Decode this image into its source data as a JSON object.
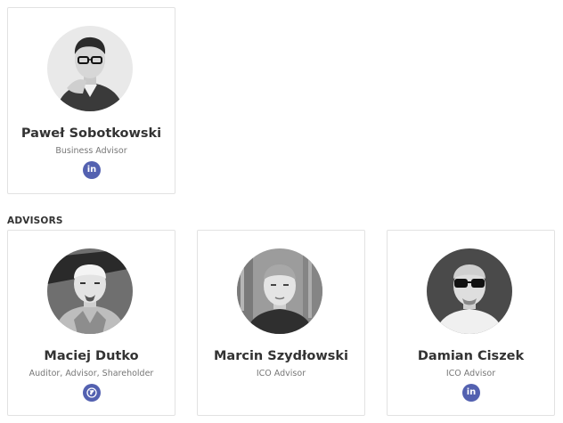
{
  "featured": {
    "name": "Paweł Sobotkowski",
    "role": "Business Advisor",
    "link_icon": "linkedin-icon",
    "link_glyph": "in"
  },
  "advisors": {
    "heading": "ADVISORS",
    "people": [
      {
        "name": "Maciej Dutko",
        "role": "Auditor, Advisor, Shareholder",
        "link_icon": "globe-icon"
      },
      {
        "name": "Marcin Szydłowski",
        "role": "ICO Advisor",
        "link_icon": "none"
      },
      {
        "name": "Damian Ciszek",
        "role": "ICO Advisor",
        "link_icon": "linkedin-icon",
        "link_glyph": "in"
      }
    ]
  },
  "colors": {
    "icon_badge": "#5361b0",
    "name_text": "#333333",
    "role_text": "#777777",
    "card_border": "#e2e2e2"
  }
}
